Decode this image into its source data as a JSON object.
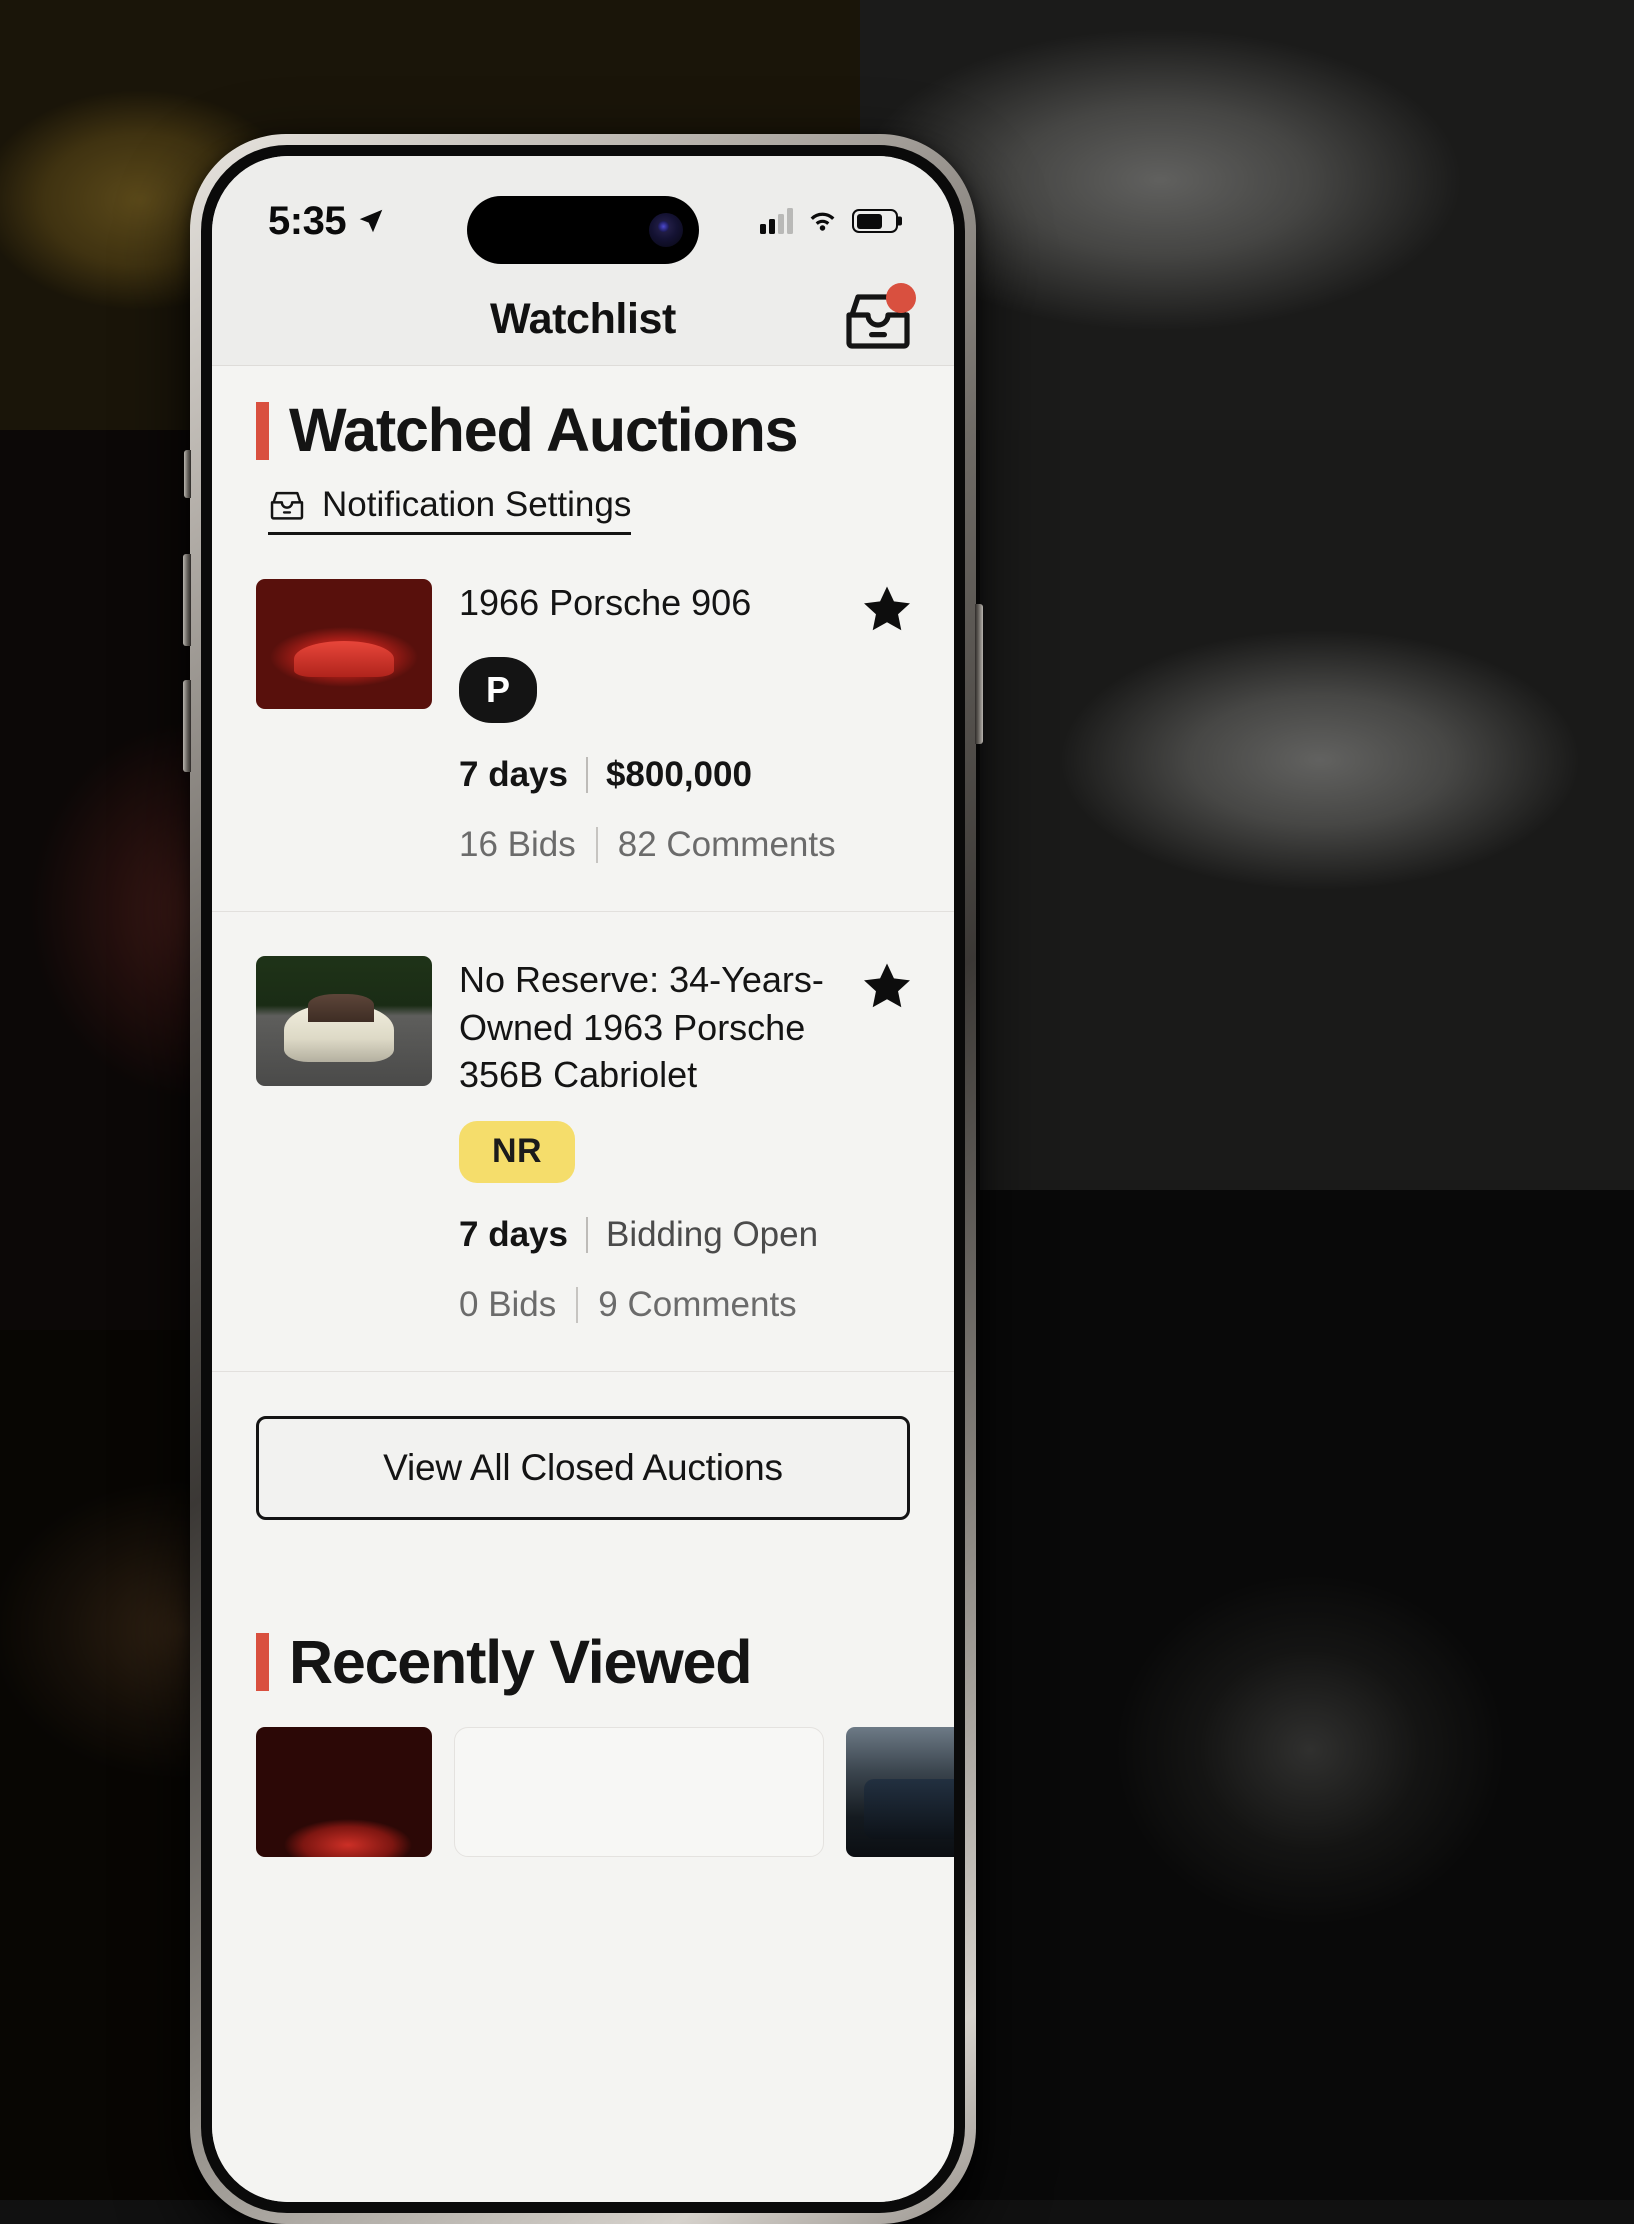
{
  "status_bar": {
    "time": "5:35",
    "location_icon": "location-arrow-icon",
    "signal_icon": "cellular-signal-icon",
    "wifi_icon": "wifi-icon",
    "battery_icon": "battery-icon"
  },
  "nav": {
    "title": "Watchlist",
    "inbox_icon": "inbox-tray-icon",
    "badge_color": "#d9503f"
  },
  "watched": {
    "heading": "Watched Auctions",
    "accent_color": "#d9503f",
    "notification_settings_label": "Notification Settings",
    "notification_settings_icon": "inbox-tray-icon",
    "items": [
      {
        "title": "1966 Porsche 906",
        "thumb_alt": "red-porsche-906-race-car",
        "badge": "P",
        "badge_type": "premium",
        "badge_bg": "#141414",
        "badge_fg": "#ffffff",
        "time_left": "7 days",
        "price": "$800,000",
        "status": "",
        "bids": "16 Bids",
        "comments": "82 Comments",
        "starred": true,
        "star_icon": "star-filled-icon"
      },
      {
        "title": "No Reserve: 34-Years-Owned 1963 Porsche 356B Cabriolet",
        "thumb_alt": "cream-porsche-356b-cabriolet",
        "badge": "NR",
        "badge_type": "no-reserve",
        "badge_bg": "#f5dd6b",
        "badge_fg": "#1b1b1b",
        "time_left": "7 days",
        "price": "",
        "status": "Bidding Open",
        "bids": "0 Bids",
        "comments": "9 Comments",
        "starred": true,
        "star_icon": "star-filled-icon"
      }
    ],
    "view_all_closed_label": "View All Closed Auctions"
  },
  "recently_viewed": {
    "heading": "Recently Viewed",
    "accent_color": "#d9503f",
    "cards": [
      {
        "thumb_alt": "red-car-in-trees"
      },
      {
        "thumb_alt": "listing-card-partial"
      },
      {
        "thumb_alt": "dark-green-offroad-vehicle"
      }
    ]
  }
}
